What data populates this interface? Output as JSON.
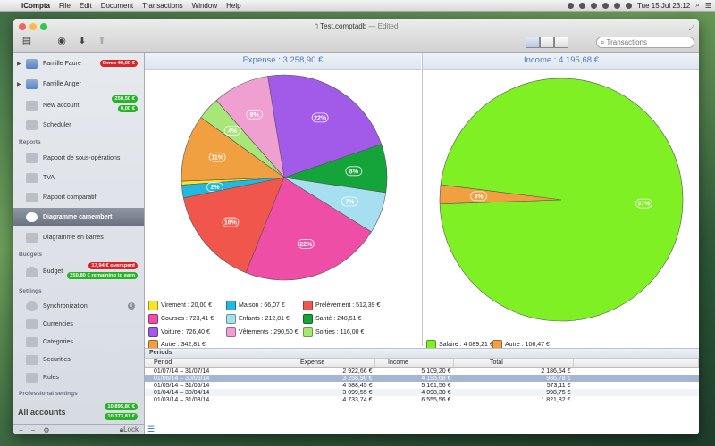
{
  "menubar": {
    "app": "iCompta",
    "items": [
      "File",
      "Edit",
      "Document",
      "Transactions",
      "Window",
      "Help"
    ],
    "clock": "Tue 15 Jul  23:12"
  },
  "window": {
    "title": "Test.comptadb",
    "edited": "— Edited",
    "search_placeholder": "Transactions"
  },
  "sidebar": {
    "accounts": [
      {
        "label": "Famille Faure",
        "badge": "Owes 40,00 €"
      },
      {
        "label": "Famille Anger"
      },
      {
        "label": "New account",
        "badges": [
          "250,50 €",
          "0,00 €"
        ]
      },
      {
        "label": "Scheduler"
      }
    ],
    "reports_header": "Reports",
    "reports": [
      {
        "label": "Rapport de sous-opérations"
      },
      {
        "label": "TVA"
      },
      {
        "label": "Rapport comparatif"
      },
      {
        "label": "Diagramme camembert"
      },
      {
        "label": "Diagramme en barres"
      }
    ],
    "budgets_header": "Budgets",
    "budget": {
      "label": "Budget",
      "overspent": "17,94 € overspent",
      "remaining": "250,80 € remaining to earn"
    },
    "settings_header": "Settings",
    "settings": [
      {
        "label": "Synchronization"
      },
      {
        "label": "Currencies"
      },
      {
        "label": "Categories"
      },
      {
        "label": "Securities"
      },
      {
        "label": "Rules"
      }
    ],
    "professional_header": "Professional settings",
    "all_accounts": {
      "label": "All accounts",
      "badges": [
        "10 895,80 €",
        "10 373,81 €"
      ]
    },
    "bottom": {
      "add": "+",
      "remove": "−",
      "gear": "⚙",
      "lock": "Lock"
    }
  },
  "expense": {
    "title": "Expense : 3 258,90 €",
    "legend": [
      {
        "label": "Virement : 20,00 €",
        "color": "#f6e52a"
      },
      {
        "label": "Maison : 66,07 €",
        "color": "#22b9e0"
      },
      {
        "label": "Prélèvement : 512,39 €",
        "color": "#f0564b"
      },
      {
        "label": "Courses : 723,41 €",
        "color": "#ee4ea6"
      },
      {
        "label": "Enfants : 212,81 €",
        "color": "#a6e0f0"
      },
      {
        "label": "Santé : 248,51 €",
        "color": "#14a43a"
      },
      {
        "label": "Voiture : 726,40 €",
        "color": "#a25ae8"
      },
      {
        "label": "Vêtements : 290,50 €",
        "color": "#f0a0d0"
      },
      {
        "label": "Sorties : 116,00 €",
        "color": "#a8e678"
      },
      {
        "label": "Autre : 342,81 €",
        "color": "#f0a040"
      }
    ]
  },
  "income": {
    "title": "Income : 4 195,68 €",
    "legend": [
      {
        "label": "Salaire : 4 089,21 €",
        "color": "#7ef024"
      },
      {
        "label": "Autre : 106,47 €",
        "color": "#f0a040"
      }
    ]
  },
  "chart_data": [
    {
      "type": "pie",
      "title": "Expense : 3 258,90 €",
      "categories": [
        "Virement",
        "Maison",
        "Prélèvement",
        "Courses",
        "Enfants",
        "Santé",
        "Voiture",
        "Vêtements",
        "Sorties",
        "Autre"
      ],
      "values": [
        20.0,
        66.07,
        512.39,
        723.41,
        212.81,
        248.51,
        726.4,
        290.5,
        116.0,
        342.81
      ],
      "labels": [
        "",
        "2%",
        "16%",
        "22%",
        "7%",
        "8%",
        "22%",
        "9%",
        "4%",
        "11%"
      ],
      "colors": [
        "#f6e52a",
        "#22b9e0",
        "#f0564b",
        "#ee4ea6",
        "#a6e0f0",
        "#14a43a",
        "#a25ae8",
        "#f0a0d0",
        "#a8e678",
        "#f0a040"
      ]
    },
    {
      "type": "pie",
      "title": "Income : 4 195,68 €",
      "categories": [
        "Salaire",
        "Autre"
      ],
      "values": [
        4089.21,
        106.47
      ],
      "labels": [
        "97%",
        "3%"
      ],
      "colors": [
        "#7ef024",
        "#f0a040"
      ]
    }
  ],
  "periods": {
    "title": "Periods",
    "columns": [
      "Period",
      "Expense",
      "Income",
      "Total"
    ],
    "rows": [
      [
        "01/07/14 – 31/07/14",
        "2 922,66 €",
        "5 109,20 €",
        "2 186,54 €"
      ],
      [
        "01/06/14 – 30/06/14",
        "3 258,90 €",
        "4 195,68 €",
        "936,78 €"
      ],
      [
        "01/05/14 – 31/05/14",
        "4 588,45 €",
        "5 161,56 €",
        "573,11 €"
      ],
      [
        "01/04/14 – 30/04/14",
        "3 099,55 €",
        "4 098,30 €",
        "998,75 €"
      ],
      [
        "01/03/14 – 31/03/14",
        "4 733,74 €",
        "6 555,56 €",
        "1 821,82 €"
      ]
    ],
    "selected_row": 1
  }
}
